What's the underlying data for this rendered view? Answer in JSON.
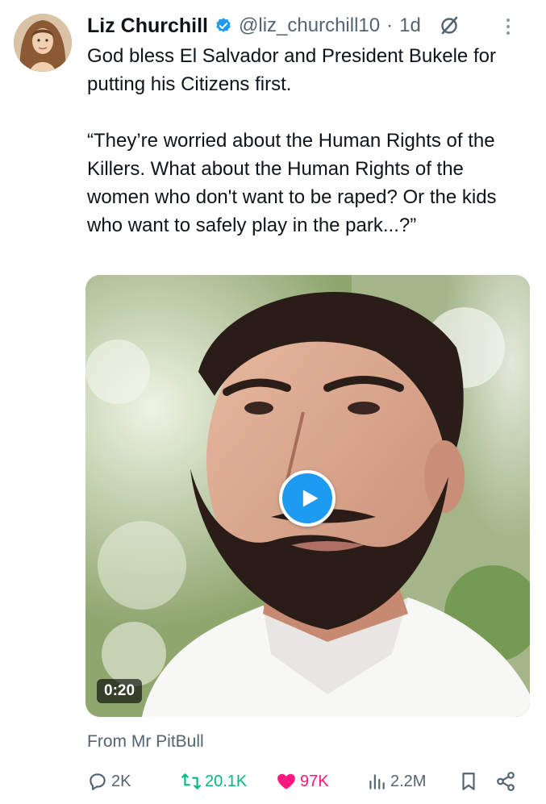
{
  "author": {
    "display_name": "Liz Churchill",
    "handle": "@liz_churchill10",
    "separator": "·",
    "age": "1d",
    "verified": true,
    "avatar_icon": "avatar-photo"
  },
  "tweet": {
    "text_line1": "God bless El Salvador and President Bukele for putting his Citizens first.",
    "text_quote": "“They’re worried about the Human Rights of the Killers. What about the Human Rights of the women who don't want to be raped? Or the kids who want to safely play in the park...?”"
  },
  "media": {
    "type": "video",
    "duration": "0:20",
    "source": "From Mr PitBull"
  },
  "actions": {
    "replies": "2K",
    "reposts": "20.1K",
    "likes": "97K",
    "views": "2.2M"
  },
  "colors": {
    "accent": "#1d9bf0",
    "repost": "#00ba7c",
    "like": "#f91880",
    "muted": "#536471"
  }
}
